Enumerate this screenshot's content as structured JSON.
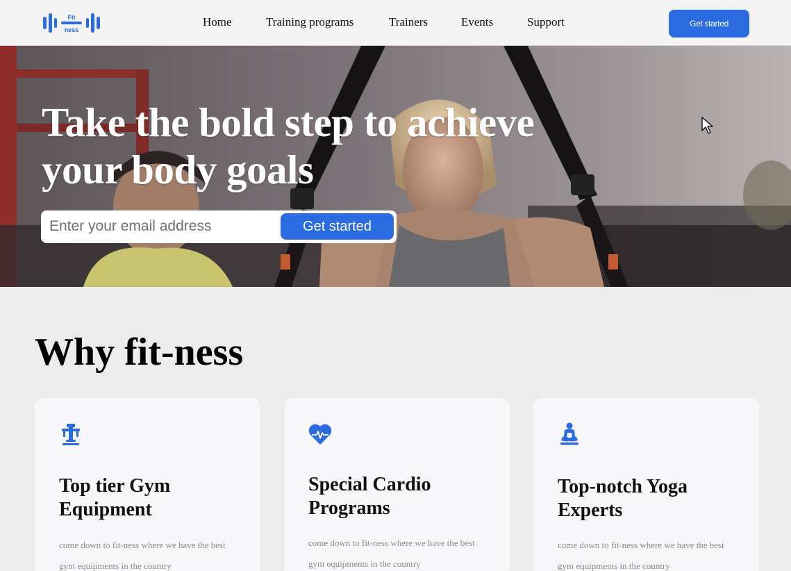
{
  "brand": {
    "logo_text_top": "Fit",
    "logo_text_bottom": "ness",
    "accent": "#2a6be2"
  },
  "nav": {
    "items": [
      {
        "label": "Home"
      },
      {
        "label": "Training programs"
      },
      {
        "label": "Trainers"
      },
      {
        "label": "Events"
      },
      {
        "label": "Support"
      }
    ],
    "cta_label": "Get started"
  },
  "hero": {
    "title": "Take the bold step to achieve your body goals",
    "email_placeholder": "Enter your email address",
    "button_label": "Get started"
  },
  "why": {
    "title": "Why fit-ness",
    "cards": [
      {
        "icon": "gym-equipment-icon",
        "title": "Top tier Gym Equipment",
        "text": "come down to fit-ness where we have the best gym equipments in the country"
      },
      {
        "icon": "heartbeat-icon",
        "title": "Special Cardio Programs",
        "text": "come down to fit-ness where we have the best gym equipments in the country"
      },
      {
        "icon": "yoga-icon",
        "title": "Top-notch Yoga Experts",
        "text": "come down to fit-ness where we have the best gym equipments in the country"
      }
    ]
  }
}
